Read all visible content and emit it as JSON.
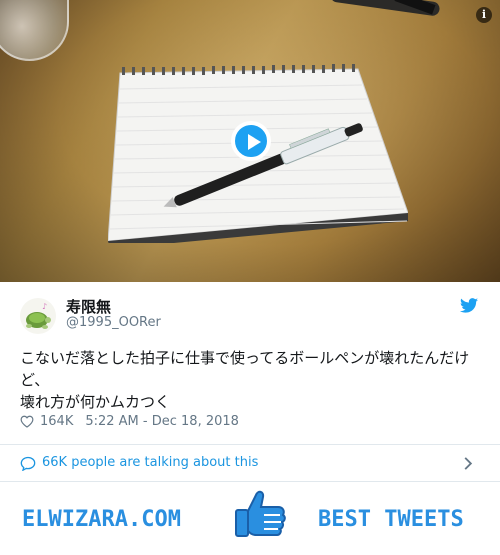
{
  "media": {
    "info_icon": "info-icon",
    "play_icon": "play-icon"
  },
  "tweet": {
    "display_name": "寿限無",
    "handle": "@1995_OORer",
    "text": "こないだ落とした拍子に仕事で使ってるボールペンが壊れたんだけど、\n壊れ方が何かムカつく",
    "likes": "164K",
    "timestamp": "5:22 AM - Dec 18, 2018"
  },
  "talk": {
    "text": "66K people are talking about this"
  },
  "banner": {
    "left_text": "ELWIZARA.COM",
    "right_text": "BEST TWEETS"
  },
  "colors": {
    "twitter_blue": "#1da1f2",
    "banner_blue": "#2a8fe0",
    "muted": "#657786"
  }
}
